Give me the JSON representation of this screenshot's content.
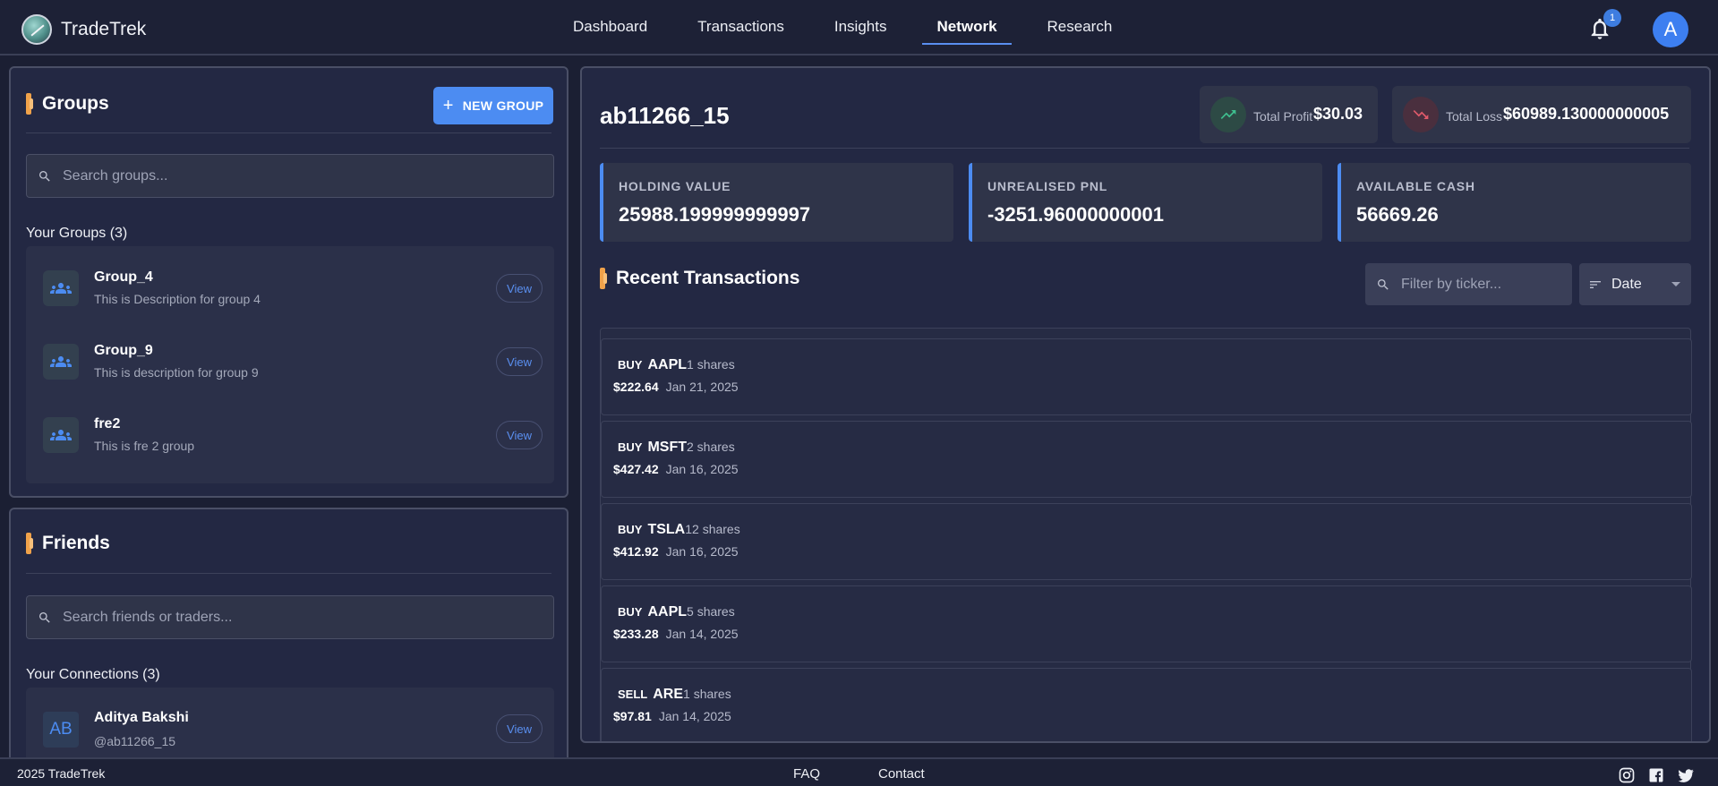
{
  "app": {
    "name": "TradeTrek"
  },
  "nav": {
    "items": [
      {
        "label": "Dashboard"
      },
      {
        "label": "Transactions"
      },
      {
        "label": "Insights"
      },
      {
        "label": "Network",
        "active": true
      },
      {
        "label": "Research"
      }
    ]
  },
  "header": {
    "notification_count": "1",
    "avatar_initial": "A"
  },
  "groups": {
    "title": "Groups",
    "new_button": "NEW GROUP",
    "search_placeholder": "Search groups...",
    "list_heading": "Your Groups (3)",
    "items": [
      {
        "name": "Group_4",
        "description": "This is Description for group 4",
        "action": "View"
      },
      {
        "name": "Group_9",
        "description": "This is description for group 9",
        "action": "View"
      },
      {
        "name": "fre2",
        "description": "This is fre 2 group",
        "action": "View"
      }
    ]
  },
  "friends": {
    "title": "Friends",
    "search_placeholder": "Search friends or traders...",
    "list_heading": "Your Connections (3)",
    "items": [
      {
        "initials": "AB",
        "name": "Aditya Bakshi",
        "handle": "@ab11266_15",
        "action": "View"
      }
    ]
  },
  "profile": {
    "username": "ab11266_15",
    "total_profit_label": "Total Profit",
    "total_profit_value": "$30.03",
    "total_loss_label": "Total Loss",
    "total_loss_value": "$60989.130000000005"
  },
  "summary": [
    {
      "label": "HOLDING VALUE",
      "value": "25988.199999999997"
    },
    {
      "label": "UNREALISED PNL",
      "value": "-3251.96000000001"
    },
    {
      "label": "AVAILABLE CASH",
      "value": "56669.26"
    }
  ],
  "transactions": {
    "title": "Recent Transactions",
    "filter_placeholder": "Filter by ticker...",
    "sort_label": "Date",
    "rows": [
      {
        "side": "BUY",
        "ticker": "AAPL",
        "shares": "1 shares",
        "price": "$222.64",
        "date": "Jan 21, 2025"
      },
      {
        "side": "BUY",
        "ticker": "MSFT",
        "shares": "2 shares",
        "price": "$427.42",
        "date": "Jan 16, 2025"
      },
      {
        "side": "BUY",
        "ticker": "TSLA",
        "shares": "12 shares",
        "price": "$412.92",
        "date": "Jan 16, 2025"
      },
      {
        "side": "BUY",
        "ticker": "AAPL",
        "shares": "5 shares",
        "price": "$233.28",
        "date": "Jan 14, 2025"
      },
      {
        "side": "SELL",
        "ticker": "ARE",
        "shares": "1 shares",
        "price": "$97.81",
        "date": "Jan 14, 2025"
      }
    ]
  },
  "footer": {
    "copyright": "2025 TradeTrek",
    "links": [
      "FAQ",
      "Contact"
    ],
    "social_icons": [
      "instagram-icon",
      "facebook-icon",
      "twitter-icon"
    ]
  },
  "colors": {
    "background": "#1b1f33",
    "panel": "#232843",
    "accent_blue": "#4c8cf2",
    "accent_orange": "#f0a24a",
    "profit_green": "#3fbf8f",
    "loss_red": "#e05a6a"
  }
}
